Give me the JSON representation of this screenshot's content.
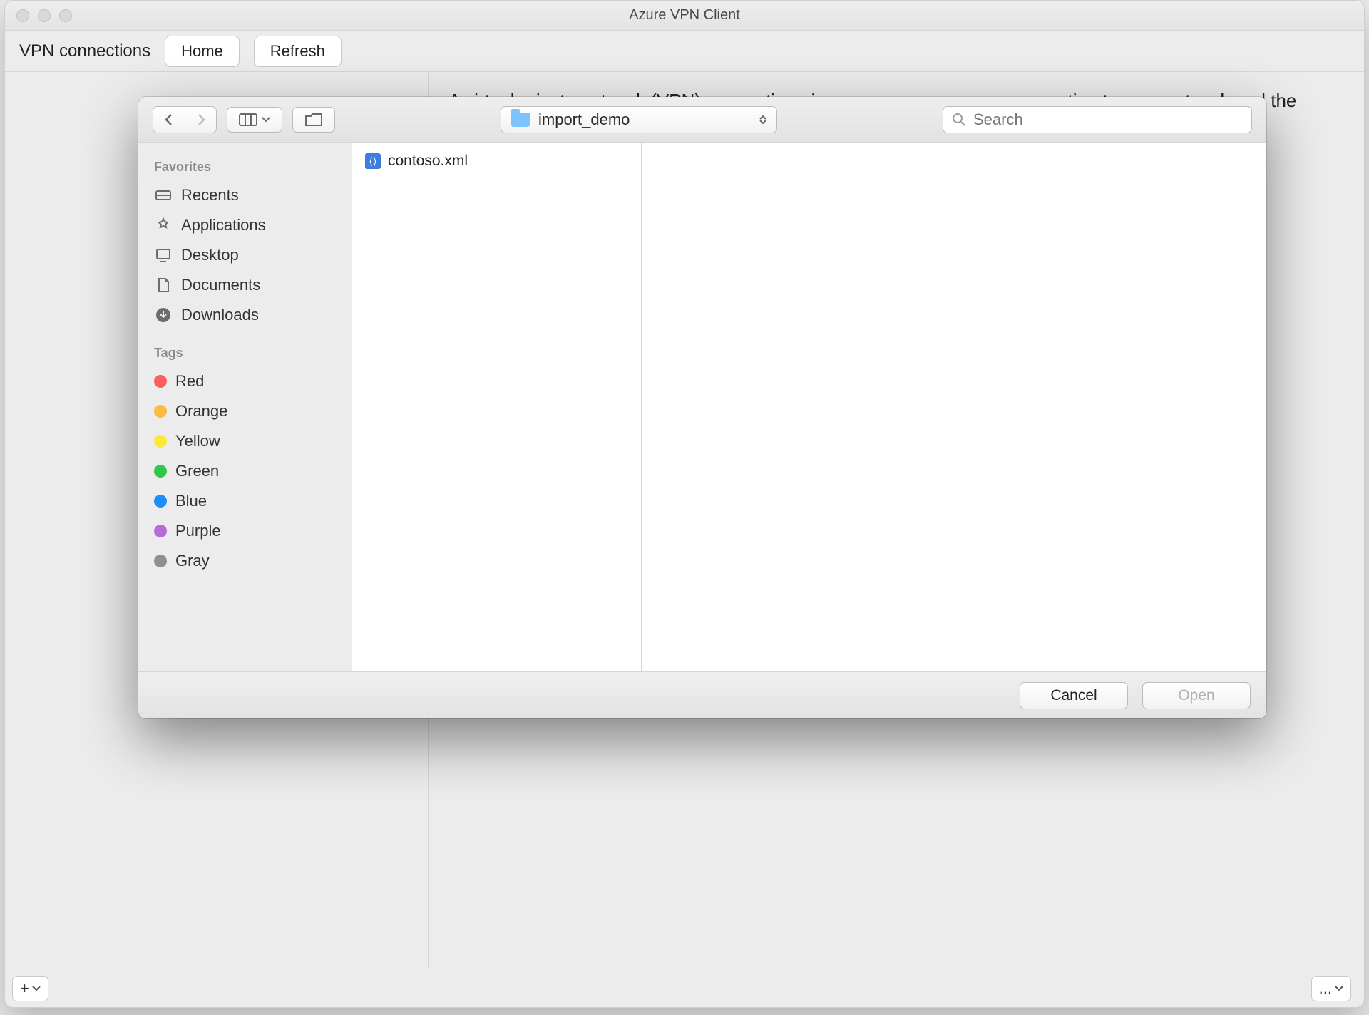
{
  "window": {
    "title": "Azure VPN Client"
  },
  "toolbar": {
    "label": "VPN connections",
    "home": "Home",
    "refresh": "Refresh"
  },
  "main": {
    "description": "A virtual private network (VPN) connection gives you a more secure connection to your network and the internet. Please create a new connection or select an existing connection to"
  },
  "bottom": {
    "add": "+",
    "more": "..."
  },
  "dialog": {
    "path": "import_demo",
    "search_placeholder": "Search",
    "sidebar": {
      "favorites_header": "Favorites",
      "favorites": [
        {
          "icon": "recents",
          "label": "Recents"
        },
        {
          "icon": "applications",
          "label": "Applications"
        },
        {
          "icon": "desktop",
          "label": "Desktop"
        },
        {
          "icon": "documents",
          "label": "Documents"
        },
        {
          "icon": "downloads",
          "label": "Downloads"
        }
      ],
      "tags_header": "Tags",
      "tags": [
        {
          "color": "#fc605c",
          "label": "Red"
        },
        {
          "color": "#fdbc40",
          "label": "Orange"
        },
        {
          "color": "#fce83a",
          "label": "Yellow"
        },
        {
          "color": "#33c748",
          "label": "Green"
        },
        {
          "color": "#1e8cfb",
          "label": "Blue"
        },
        {
          "color": "#b96ad9",
          "label": "Purple"
        },
        {
          "color": "#8e8e93",
          "label": "Gray"
        }
      ]
    },
    "files": [
      {
        "name": "contoso.xml"
      }
    ],
    "buttons": {
      "cancel": "Cancel",
      "open": "Open"
    }
  }
}
